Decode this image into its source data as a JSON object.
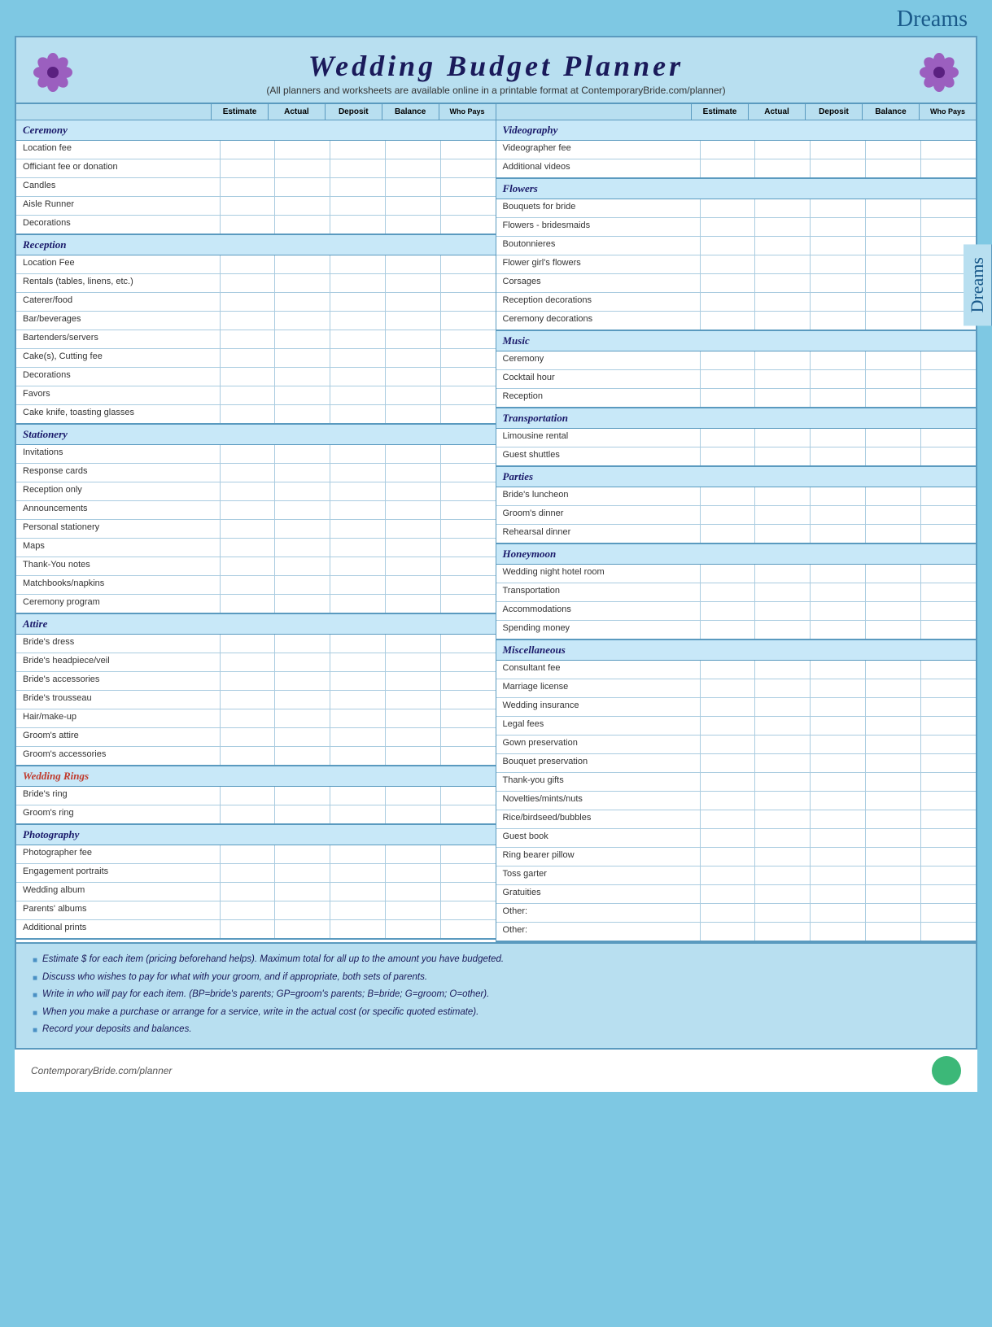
{
  "page": {
    "dreams_label": "Dreams",
    "title": "Wedding Budget Planner",
    "subtitle": "(All planners and worksheets are available online in a printable format at ContemporaryBride.com/planner)",
    "website": "ContemporaryBride.com/planner"
  },
  "columns": [
    "Estimate",
    "Actual",
    "Deposit",
    "Balance",
    "Who Pays"
  ],
  "left_sections": [
    {
      "header": "Ceremony",
      "items": [
        "Location fee",
        "Officiant fee or donation",
        "Candles",
        "Aisle Runner",
        "Decorations"
      ]
    },
    {
      "header": "Reception",
      "items": [
        "Location Fee",
        "Rentals (tables, linens, etc.)",
        "Caterer/food",
        "Bar/beverages",
        "Bartenders/servers",
        "Cake(s), Cutting fee",
        "Decorations",
        "Favors",
        "Cake knife, toasting glasses"
      ]
    },
    {
      "header": "Stationery",
      "items": [
        "Invitations",
        "Response cards",
        "Reception only",
        "Announcements",
        "Personal stationery",
        "Maps",
        "Thank-You notes",
        "Matchbooks/napkins",
        "Ceremony program"
      ]
    },
    {
      "header": "Attire",
      "items": [
        "Bride's dress",
        "Bride's headpiece/veil",
        "Bride's accessories",
        "Bride's trousseau",
        "Hair/make-up",
        "Groom's attire",
        "Groom's accessories"
      ]
    },
    {
      "header": "Wedding Rings",
      "items": [
        "Bride's ring",
        "Groom's ring"
      ]
    },
    {
      "header": "Photography",
      "items": [
        "Photographer fee",
        "Engagement portraits",
        "Wedding album",
        "Parents' albums",
        "Additional prints"
      ]
    }
  ],
  "right_sections": [
    {
      "header": "Videography",
      "items": [
        "Videographer fee",
        "Additional videos"
      ]
    },
    {
      "header": "Flowers",
      "items": [
        "Bouquets for bride",
        "Flowers - bridesmaids",
        "Boutonnieres",
        "Flower girl's flowers",
        "Corsages",
        "Reception decorations",
        "Ceremony decorations"
      ]
    },
    {
      "header": "Music",
      "items": [
        "Ceremony",
        "Cocktail hour",
        "Reception"
      ]
    },
    {
      "header": "Transportation",
      "items": [
        "Limousine rental",
        "Guest shuttles"
      ]
    },
    {
      "header": "Parties",
      "items": [
        "Bride's luncheon",
        "Groom's dinner",
        "Rehearsal dinner"
      ]
    },
    {
      "header": "Honeymoon",
      "items": [
        "Wedding night hotel room",
        "Transportation",
        "Accommodations",
        "Spending money"
      ]
    },
    {
      "header": "Miscellaneous",
      "items": [
        "Consultant fee",
        "Marriage license",
        "Wedding insurance",
        "Legal fees",
        "Gown preservation",
        "Bouquet preservation",
        "Thank-you gifts",
        "Novelties/mints/nuts",
        "Rice/birdseed/bubbles",
        "Guest book",
        "Ring bearer pillow",
        "Toss garter",
        "Gratuities",
        "Other:",
        "Other:"
      ]
    }
  ],
  "footer_notes": [
    "Estimate $ for each item (pricing beforehand helps). Maximum total for all up to the amount you have budgeted.",
    "Discuss who wishes to pay for what with your groom, and if appropriate, both sets of parents.",
    "Write in who will pay for each item. (BP=bride's parents; GP=groom's parents; B=bride; G=groom; O=other).",
    "When you make a purchase or arrange for a service, write in the actual cost (or specific quoted estimate).",
    "Record your deposits and balances."
  ]
}
